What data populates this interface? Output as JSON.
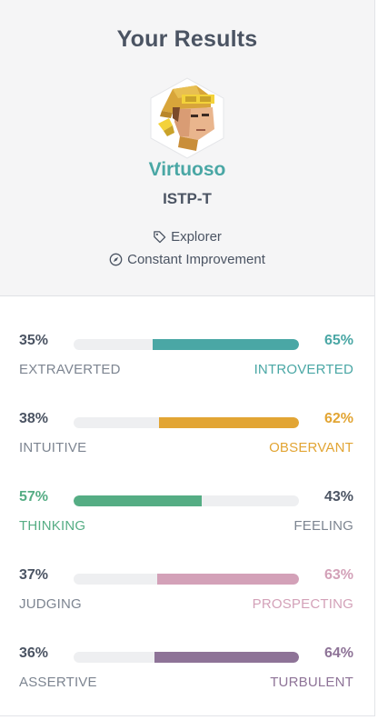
{
  "results": {
    "title": "Your Results",
    "type_name": "Virtuoso",
    "type_code": "ISTP-T",
    "role": "Explorer",
    "strategy": "Constant Improvement",
    "icons": {
      "role": "tag-icon",
      "strategy": "compass-icon",
      "avatar": "virtuoso-avatar"
    }
  },
  "colors": {
    "energy": "#4aa7a5",
    "nature": "#e2a534",
    "mind": "#55ad84",
    "tactics": "#d3a1b8",
    "identity": "#8e7397",
    "muted": "#7d8591",
    "dark": "#4b5463"
  },
  "traits": [
    {
      "left_pct": "35%",
      "left_label": "EXTRAVERTED",
      "right_pct": "65%",
      "right_label": "INTROVERTED",
      "dominant": "right",
      "value": 65,
      "color": "#4aa7a5"
    },
    {
      "left_pct": "38%",
      "left_label": "INTUITIVE",
      "right_pct": "62%",
      "right_label": "OBSERVANT",
      "dominant": "right",
      "value": 62,
      "color": "#e2a534"
    },
    {
      "left_pct": "57%",
      "left_label": "THINKING",
      "right_pct": "43%",
      "right_label": "FEELING",
      "dominant": "left",
      "value": 57,
      "color": "#55ad84"
    },
    {
      "left_pct": "37%",
      "left_label": "JUDGING",
      "right_pct": "63%",
      "right_label": "PROSPECTING",
      "dominant": "right",
      "value": 63,
      "color": "#d3a1b8"
    },
    {
      "left_pct": "36%",
      "left_label": "ASSERTIVE",
      "right_pct": "64%",
      "right_label": "TURBULENT",
      "dominant": "right",
      "value": 64,
      "color": "#8e7397"
    }
  ]
}
